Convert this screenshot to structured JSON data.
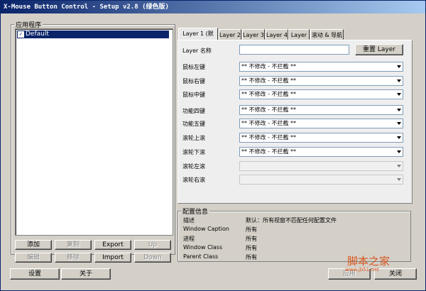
{
  "window": {
    "title": "X-Mouse Button Control - Setup v2.8 (绿色版)"
  },
  "apps": {
    "group_label": "应用程序",
    "items": [
      {
        "label": "Default",
        "checked": true
      }
    ]
  },
  "app_buttons": {
    "add": "添加",
    "copy": "复制",
    "export": "Export",
    "up": "Up",
    "edit": "编辑",
    "remove": "移除",
    "import": "Import",
    "down": "Down"
  },
  "tabs": [
    {
      "label": "Layer 1 (默认)",
      "active": true
    },
    {
      "label": "Layer 2",
      "active": false
    },
    {
      "label": "Layer 3",
      "active": false
    },
    {
      "label": "Layer 4",
      "active": false
    },
    {
      "label": "Layer 5",
      "active": false
    },
    {
      "label": "滚动 & 导航",
      "active": false
    }
  ],
  "layer": {
    "name_label": "Layer 名称",
    "name_value": "",
    "reset_button": "重置 Layer",
    "rows": [
      {
        "label": "鼠标左键",
        "value": "** 不修改 - 不拦截 **",
        "enabled": true
      },
      {
        "label": "鼠标右键",
        "value": "** 不修改 - 不拦截 **",
        "enabled": true
      },
      {
        "label": "鼠标中键",
        "value": "** 不修改 - 不拦截 **",
        "enabled": true
      },
      {
        "label": "功能四键",
        "value": "** 不修改 - 不拦截 **",
        "enabled": true
      },
      {
        "label": "功能五键",
        "value": "** 不修改 - 不拦截 **",
        "enabled": true
      },
      {
        "label": "滚轮上滚",
        "value": "** 不修改 - 不拦截 **",
        "enabled": true
      },
      {
        "label": "滚轮下滚",
        "value": "** 不修改 - 不拦截 **",
        "enabled": true
      },
      {
        "label": "滚轮左滚",
        "value": "",
        "enabled": false
      },
      {
        "label": "滚轮右滚",
        "value": "",
        "enabled": false
      }
    ]
  },
  "config_info": {
    "group_label": "配置信息",
    "rows": [
      {
        "label": "描述",
        "value": "默认：所有视窗不匹配任何配置文件"
      },
      {
        "label": "Window Caption",
        "value": "所有"
      },
      {
        "label": "进程",
        "value": "所有"
      },
      {
        "label": "Window Class",
        "value": "所有"
      },
      {
        "label": "Parent Class",
        "value": "所有"
      }
    ]
  },
  "footer": {
    "settings": "设置",
    "about": "关于",
    "apply": "应用",
    "close": "关闭"
  },
  "watermark": {
    "text": "脚本之家",
    "url": "www.jb51.net"
  }
}
